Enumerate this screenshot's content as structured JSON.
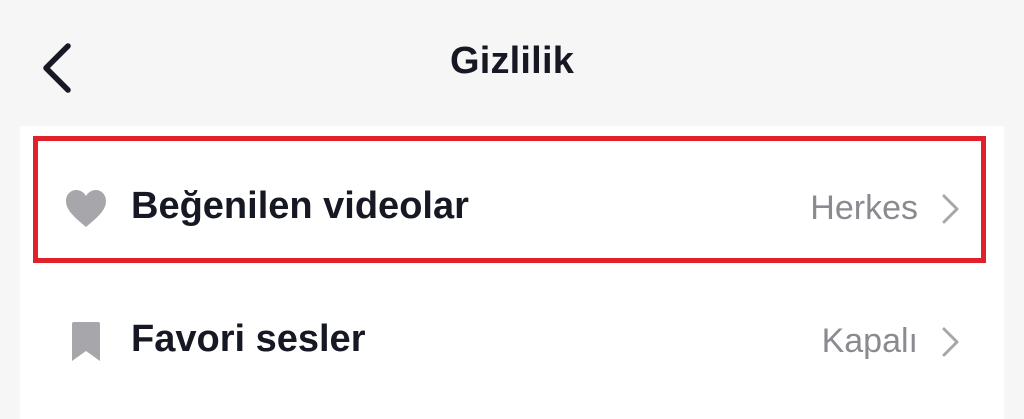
{
  "header": {
    "title": "Gizlilik"
  },
  "rows": [
    {
      "icon": "heart-icon",
      "label": "Beğenilen videolar",
      "value": "Herkes",
      "highlighted": true
    },
    {
      "icon": "bookmark-icon",
      "label": "Favori sesler",
      "value": "Kapalı",
      "highlighted": false
    }
  ],
  "colors": {
    "background": "#f6f6f6",
    "card": "#ffffff",
    "text": "#161823",
    "secondary_text": "#8a8b91",
    "icon": "#a7a7ab",
    "highlight_border": "#e0202b"
  }
}
